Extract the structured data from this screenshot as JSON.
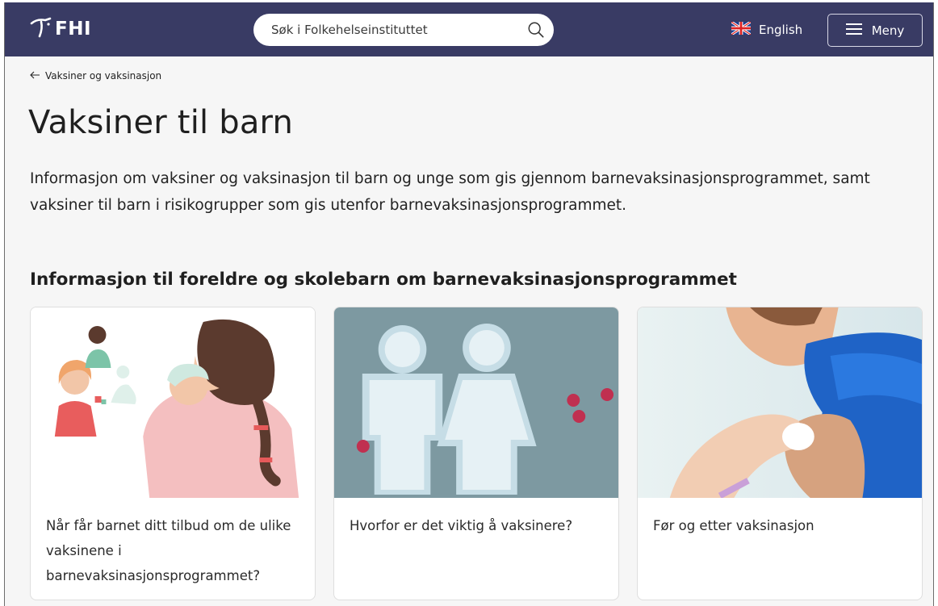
{
  "header": {
    "logo_text": "FHI",
    "search_placeholder": "Søk i Folkehelseinstituttet",
    "language_label": "English",
    "menu_label": "Meny"
  },
  "breadcrumb": {
    "back_label": "Vaksiner og vaksinasjon"
  },
  "page": {
    "title": "Vaksiner til barn",
    "lead": "Informasjon om vaksiner og vaksinasjon til barn og unge som gis gjennom barnevaksinasjonsprogrammet, samt vaksiner til barn i risikogrupper som gis utenfor barnevaksinasjonsprogrammet."
  },
  "section": {
    "title": "Informasjon til foreldre og skolebarn om barnevaksinasjonsprogrammet",
    "cards": [
      {
        "label": "Når får barnet ditt tilbud om de ulike vaksinene i barnevaksinasjonsprogrammet?"
      },
      {
        "label": "Hvorfor er det viktig å vaksinere?"
      },
      {
        "label": "Før og etter vaksinasjon"
      }
    ]
  },
  "icons": {
    "logo": "fhi-logo-icon",
    "search": "search-icon",
    "flag": "uk-flag-icon",
    "menu": "hamburger-icon",
    "back": "arrow-left-icon"
  },
  "colors": {
    "header_bg": "#393b64",
    "page_bg": "#f6f6f6"
  }
}
